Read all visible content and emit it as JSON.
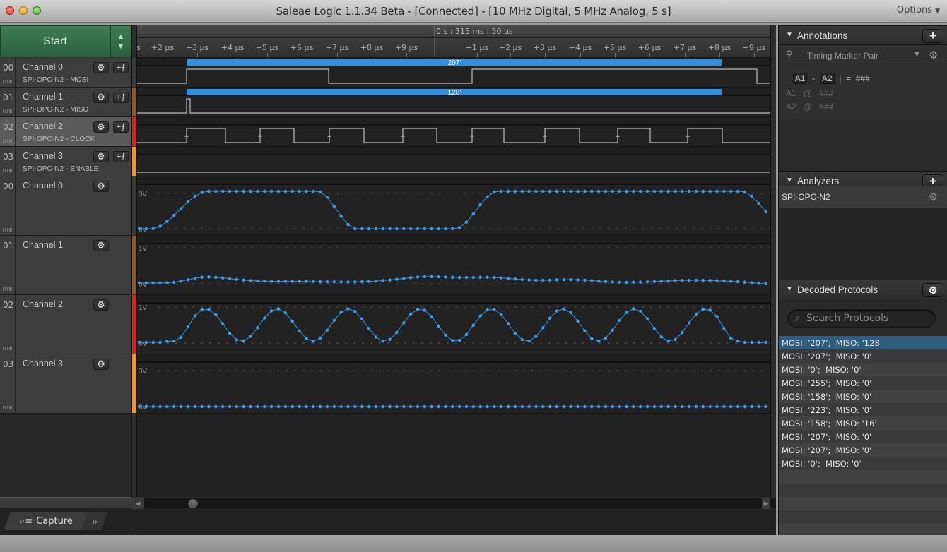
{
  "window": {
    "title": "Saleae Logic 1.1.34 Beta - [Connected] - [10 MHz Digital, 5 MHz Analog, 5 s]",
    "options_label": "Options"
  },
  "toolbar": {
    "start_label": "Start",
    "up_arrow": "▲",
    "down_arrow": "▼"
  },
  "ruler": {
    "center_time": "0 s : 315 ms : 50 µs",
    "left_ticks": [
      "s",
      "+2 µs",
      "+3 µs",
      "+4 µs",
      "+5 µs",
      "+6 µs",
      "+7 µs",
      "+8 µs",
      "+9 µs"
    ],
    "right_ticks": [
      "+1 µs",
      "+2 µs",
      "+3 µs",
      "+4 µs",
      "+5 µs",
      "+6 µs",
      "+7 µs",
      "+8 µs",
      "+9 µs"
    ]
  },
  "digital_channels": [
    {
      "num": "00",
      "name": "Channel 0",
      "sub": "SPI-OPC-N2 - MOSI",
      "color": "#3a3a3a",
      "selected": false,
      "annotation": "'207'",
      "levels": [
        0,
        1,
        0,
        1,
        0
      ]
    },
    {
      "num": "01",
      "name": "Channel 1",
      "sub": "SPI-OPC-N2 - MISO",
      "color": "#8a5a2a",
      "selected": false,
      "annotation": "'128'",
      "levels": [
        0,
        1,
        0
      ]
    },
    {
      "num": "02",
      "name": "Channel 2",
      "sub": "SPI-OPC-N2 - CLOCK",
      "color": "#cc2a2a",
      "selected": true,
      "annotation": "",
      "levels": []
    },
    {
      "num": "03",
      "name": "Channel 3",
      "sub": "SPI-OPC-N2 - ENABLE",
      "color": "#e89a20",
      "selected": false,
      "annotation": "",
      "levels": [
        0
      ]
    }
  ],
  "analog_channels": [
    {
      "num": "00",
      "name": "Channel 0",
      "color": "#3a3a3a",
      "top_label": "3V",
      "bottom_label": "0V"
    },
    {
      "num": "01",
      "name": "Channel 1",
      "color": "#8a5a2a",
      "top_label": "1V",
      "bottom_label": "0V"
    },
    {
      "num": "02",
      "name": "Channel 2",
      "color": "#cc2a2a",
      "top_label": "1V",
      "bottom_label": "0V"
    },
    {
      "num": "03",
      "name": "Channel 3",
      "color": "#e89a20",
      "top_label": "3V",
      "bottom_label": "0V"
    }
  ],
  "icons": {
    "gear": "⚙",
    "trigger": "+⨍",
    "plus": "+",
    "triangle_down": "▼",
    "pin": "⚲",
    "search": "⌕",
    "capture_icon": "⌕≡",
    "more": "»",
    "scroll_left": "◀",
    "scroll_right": "▶"
  },
  "bottom_tabs": {
    "capture_label": "Capture"
  },
  "annotations_panel": {
    "title": "Annotations",
    "type_label": "Timing Marker Pair",
    "row1": {
      "bar1": "|",
      "a1": "A1",
      "dash": "-",
      "a2": "A2",
      "bar2": "|",
      "eq": "=",
      "value": "###"
    },
    "row2": {
      "marker": "A1",
      "at": "@",
      "value": "###"
    },
    "row3": {
      "marker": "A2",
      "at": "@",
      "value": "###"
    }
  },
  "analyzers_panel": {
    "title": "Analyzers",
    "items": [
      {
        "name": "SPI-OPC-N2"
      }
    ]
  },
  "decoded_panel": {
    "title": "Decoded Protocols",
    "search_placeholder": "Search Protocols",
    "rows": [
      "MOSI: '207';  MISO: '128'",
      "MOSI: '207';  MISO: '0'",
      "MOSI: '0';  MISO: '0'",
      "MOSI: '255';  MISO: '0'",
      "MOSI: '158';  MISO: '0'",
      "MOSI: '223';  MISO: '0'",
      "MOSI: '158';  MISO: '16'",
      "MOSI: '207';  MISO: '0'",
      "MOSI: '207';  MISO: '0'",
      "MOSI: '0';  MISO: '0'"
    ],
    "selected_index": 0
  }
}
